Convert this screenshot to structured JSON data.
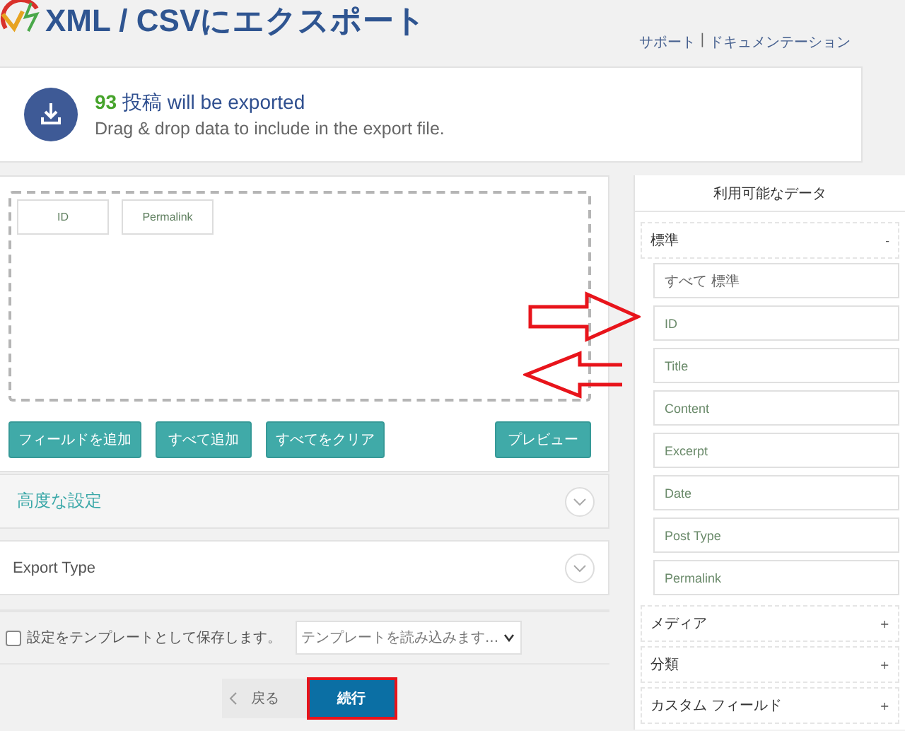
{
  "header": {
    "title": "XML / CSVにエクスポート",
    "links": [
      "サポート",
      "ドキュメンテーション"
    ],
    "separator": "|"
  },
  "notice": {
    "count": "93",
    "headline": "投稿 will be exported",
    "subtext": "Drag & drop data to include in the export file."
  },
  "drop_zone": {
    "fields": [
      "ID",
      "Permalink"
    ]
  },
  "buttons": [
    {
      "label": "フィールドを追加",
      "kind": "left"
    },
    {
      "label": "すべて追加",
      "kind": "left"
    },
    {
      "label": "すべてをクリア",
      "kind": "left"
    },
    {
      "label": "プレビュー",
      "kind": "right"
    }
  ],
  "sections": [
    {
      "title": "高度な設定",
      "kind": "shaded"
    },
    {
      "title": "Export Type",
      "kind": "plain"
    }
  ],
  "template": {
    "save_label": "設定をテンプレートとして保存します。",
    "checked": false,
    "load_value": "テンプレートを読み込みます..."
  },
  "nav": {
    "back": "戻る",
    "continue": "続行",
    "highlighted": true
  },
  "available": {
    "title": "利用可能なデータ",
    "groups": [
      {
        "name": "標準",
        "toggle": "-",
        "items": [
          "すべて 標準",
          "ID",
          "Title",
          "Content",
          "Excerpt",
          "Date",
          "Post Type",
          "Permalink"
        ]
      },
      {
        "name": "メディア",
        "toggle": "+"
      },
      {
        "name": "分類",
        "toggle": "+"
      },
      {
        "name": "カスタム フィールド",
        "toggle": "+"
      }
    ]
  }
}
